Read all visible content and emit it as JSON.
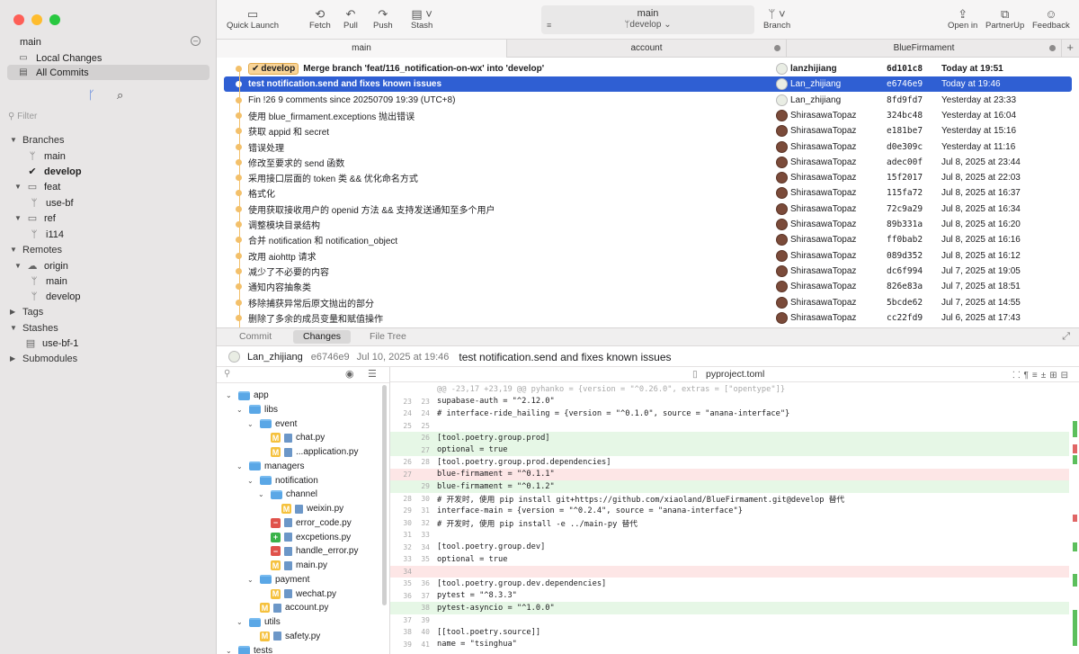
{
  "sidebar": {
    "repo": "main",
    "local_changes": "Local Changes",
    "all_commits": "All Commits",
    "filter_placeholder": "Filter",
    "branches_label": "Branches",
    "branch_main": "main",
    "branch_develop": "develop",
    "feat_folder": "feat",
    "feat_use_bf": "use-bf",
    "ref_folder": "ref",
    "ref_i114": "i114",
    "remotes_label": "Remotes",
    "origin": "origin",
    "origin_main": "main",
    "origin_develop": "develop",
    "tags_label": "Tags",
    "stashes_label": "Stashes",
    "stash_use_bf_1": "use-bf-1",
    "submodules_label": "Submodules"
  },
  "toolbar": {
    "quick_launch": "Quick Launch",
    "fetch": "Fetch",
    "pull": "Pull",
    "push": "Push",
    "stash": "Stash",
    "repo": "main",
    "branch": "develop",
    "branch_btn": "Branch",
    "open_in": "Open in",
    "partnerup": "PartnerUp",
    "feedback": "Feedback"
  },
  "tabs": [
    "main",
    "account",
    "BlueFirmament"
  ],
  "commits": [
    {
      "badge": "develop",
      "msg": "Merge branch 'feat/116_notification-on-wx' into 'develop'",
      "author": "lanzhijiang",
      "hash": "6d101c8",
      "date": "Today at 19:51"
    },
    {
      "msg": "test notification.send and fixes known issues",
      "author": "Lan_zhijiang",
      "hash": "e6746e9",
      "date": "Today at 19:46"
    },
    {
      "msg": "Fin !26 9 comments since 20250709 19:39 (UTC+8)",
      "author": "Lan_zhijiang",
      "hash": "8fd9fd7",
      "date": "Yesterday at 23:33"
    },
    {
      "msg": "使用 blue_firmament.exceptions 抛出错误",
      "author": "ShirasawaTopaz",
      "hash": "324bc48",
      "date": "Yesterday at 16:04"
    },
    {
      "msg": "获取 appid 和 secret",
      "author": "ShirasawaTopaz",
      "hash": "e181be7",
      "date": "Yesterday at 15:16"
    },
    {
      "msg": "错误处理",
      "author": "ShirasawaTopaz",
      "hash": "d0e309c",
      "date": "Yesterday at 11:16"
    },
    {
      "msg": "修改至要求的 send 函数",
      "author": "ShirasawaTopaz",
      "hash": "adec00f",
      "date": "Jul 8, 2025 at 23:44"
    },
    {
      "msg": "采用接口层面的 token 类 && 优化命名方式",
      "author": "ShirasawaTopaz",
      "hash": "15f2017",
      "date": "Jul 8, 2025 at 22:03"
    },
    {
      "msg": "格式化",
      "author": "ShirasawaTopaz",
      "hash": "115fa72",
      "date": "Jul 8, 2025 at 16:37"
    },
    {
      "msg": "使用获取接收用户的 openid 方法  && 支持发送通知至多个用户",
      "author": "ShirasawaTopaz",
      "hash": "72c9a29",
      "date": "Jul 8, 2025 at 16:34"
    },
    {
      "msg": "调整模块目录结构",
      "author": "ShirasawaTopaz",
      "hash": "89b331a",
      "date": "Jul 8, 2025 at 16:20"
    },
    {
      "msg": "合并 notification 和 notification_object",
      "author": "ShirasawaTopaz",
      "hash": "ff0bab2",
      "date": "Jul 8, 2025 at 16:16"
    },
    {
      "msg": "改用 aiohttp 请求",
      "author": "ShirasawaTopaz",
      "hash": "089d352",
      "date": "Jul 8, 2025 at 16:12"
    },
    {
      "msg": "减少了不必要的内容",
      "author": "ShirasawaTopaz",
      "hash": "dc6f994",
      "date": "Jul 7, 2025 at 19:05"
    },
    {
      "msg": "通知内容抽象类",
      "author": "ShirasawaTopaz",
      "hash": "826e83a",
      "date": "Jul 7, 2025 at 18:51"
    },
    {
      "msg": "移除捕获异常后原文抛出的部分",
      "author": "ShirasawaTopaz",
      "hash": "5bcde62",
      "date": "Jul 7, 2025 at 14:55"
    },
    {
      "msg": "删除了多余的成员变量和赋值操作",
      "author": "ShirasawaTopaz",
      "hash": "cc22fd9",
      "date": "Jul 6, 2025 at 17:43"
    }
  ],
  "detail_tabs": [
    "Commit",
    "Changes",
    "File Tree"
  ],
  "detail": {
    "author": "Lan_zhijiang",
    "hash": "e6746e9",
    "date": "Jul 10, 2025 at 19:46",
    "message": "test notification.send and fixes known issues",
    "file": "pyproject.toml"
  },
  "tree": [
    {
      "name": "app",
      "type": "folder"
    },
    {
      "name": "libs",
      "type": "folder"
    },
    {
      "name": "event",
      "type": "folder"
    },
    {
      "name": "chat.py",
      "type": "file",
      "status": "M"
    },
    {
      "name": "...application.py",
      "type": "file",
      "status": "M"
    },
    {
      "name": "managers",
      "type": "folder"
    },
    {
      "name": "notification",
      "type": "folder"
    },
    {
      "name": "channel",
      "type": "folder"
    },
    {
      "name": "weixin.py",
      "type": "file",
      "status": "M"
    },
    {
      "name": "error_code.py",
      "type": "file",
      "status": "D"
    },
    {
      "name": "excpetions.py",
      "type": "file",
      "status": "A"
    },
    {
      "name": "handle_error.py",
      "type": "file",
      "status": "D"
    },
    {
      "name": "main.py",
      "type": "file",
      "status": "M"
    },
    {
      "name": "payment",
      "type": "folder"
    },
    {
      "name": "wechat.py",
      "type": "file",
      "status": "M"
    },
    {
      "name": "account.py",
      "type": "file",
      "status": "M"
    },
    {
      "name": "utils",
      "type": "folder"
    },
    {
      "name": "safety.py",
      "type": "file",
      "status": "M"
    },
    {
      "name": "tests",
      "type": "folder"
    }
  ],
  "diff": [
    {
      "o": "",
      "n": "",
      "t": "@@ -23,17 +23,19 @@ pyhanko = {version = \"^0.26.0\", extras = [\"opentype\"]}",
      "k": "hunk"
    },
    {
      "o": "23",
      "n": "23",
      "t": "supabase-auth = \"^2.12.0\"",
      "k": ""
    },
    {
      "o": "24",
      "n": "24",
      "t": "# interface-ride_hailing = {version = \"^0.1.0\", source = \"anana-interface\"}",
      "k": ""
    },
    {
      "o": "25",
      "n": "25",
      "t": "",
      "k": ""
    },
    {
      "o": "",
      "n": "26",
      "t": "[tool.poetry.group.prod]",
      "k": "add"
    },
    {
      "o": "",
      "n": "27",
      "t": "optional = true",
      "k": "add"
    },
    {
      "o": "26",
      "n": "28",
      "t": "[tool.poetry.group.prod.dependencies]",
      "k": ""
    },
    {
      "o": "27",
      "n": "",
      "t": "blue-firmament = \"^0.1.1\"",
      "k": "del"
    },
    {
      "o": "",
      "n": "29",
      "t": "blue-firmament = \"^0.1.2\"",
      "k": "add"
    },
    {
      "o": "28",
      "n": "30",
      "t": "# 开发时, 使用 pip install git+https://github.com/xiaoland/BlueFirmament.git@develop 替代",
      "k": ""
    },
    {
      "o": "29",
      "n": "31",
      "t": "interface-main = {version = \"^0.2.4\", source = \"anana-interface\"}",
      "k": ""
    },
    {
      "o": "30",
      "n": "32",
      "t": "# 开发时, 使用 pip install -e ../main-py 替代",
      "k": ""
    },
    {
      "o": "31",
      "n": "33",
      "t": "",
      "k": ""
    },
    {
      "o": "32",
      "n": "34",
      "t": "[tool.poetry.group.dev]",
      "k": ""
    },
    {
      "o": "33",
      "n": "35",
      "t": "optional = true",
      "k": ""
    },
    {
      "o": "34",
      "n": "",
      "t": "",
      "k": "del"
    },
    {
      "o": "35",
      "n": "36",
      "t": "[tool.poetry.group.dev.dependencies]",
      "k": ""
    },
    {
      "o": "36",
      "n": "37",
      "t": "pytest = \"^8.3.3\"",
      "k": ""
    },
    {
      "o": "",
      "n": "38",
      "t": "pytest-asyncio = \"^1.0.0\"",
      "k": "add"
    },
    {
      "o": "37",
      "n": "39",
      "t": "",
      "k": ""
    },
    {
      "o": "38",
      "n": "40",
      "t": "[[tool.poetry.source]]",
      "k": ""
    },
    {
      "o": "39",
      "n": "41",
      "t": "name = \"tsinghua\"",
      "k": ""
    }
  ],
  "colors": {
    "selection": "#2f5fd3",
    "badge": "#f9d497",
    "added": "#e6f7e6",
    "deleted": "#fde6e6"
  }
}
